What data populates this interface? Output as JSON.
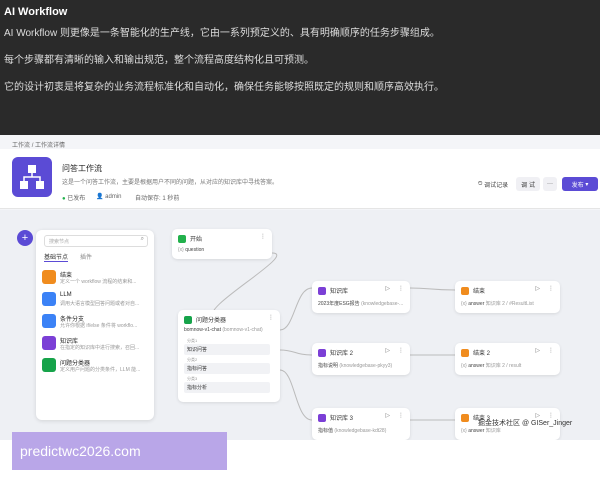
{
  "header": {
    "title": "AI Workflow",
    "lines": [
      "AI Workflow 则更像是一条智能化的生产线，它由一系列预定义的、具有明确顺序的任务步骤组成。",
      "每个步骤都有清晰的输入和输出规范，整个流程高度结构化且可预测。",
      "它的设计初衷是将复杂的业务流程标准化和自动化，确保任务能够按照既定的规则和顺序高效执行。"
    ]
  },
  "breadcrumb": {
    "root": "工作流",
    "sep": "/",
    "current": "工作流详情"
  },
  "workflow": {
    "name": "问答工作流",
    "description": "这是一个问答工作流，主要是根据用户不同的问题，从对应的知识库中寻找答案。",
    "status": "已发布",
    "owner": "admin",
    "autosave": "自动保存: 1 秒前"
  },
  "toolbar": {
    "debug_log": "调试记录",
    "debug": "调 试",
    "more": "···",
    "publish": "发布"
  },
  "panel": {
    "search_placeholder": "搜索节点",
    "tabs": [
      "基础节点",
      "插件"
    ],
    "items": [
      {
        "name": "结束",
        "desc": "定义一个 workflow 流程的结束和..."
      },
      {
        "name": "LLM",
        "desc": "调用大语言模型回答问题或者对自..."
      },
      {
        "name": "条件分支",
        "desc": "允许你根据 if/else 条件将 workflo..."
      },
      {
        "name": "知识库",
        "desc": "在指定的知识库中进行搜索，召回..."
      },
      {
        "name": "问题分类器",
        "desc": "定义用户问题的分类条件，LLM 能..."
      }
    ]
  },
  "nodes": {
    "start": {
      "title": "开始",
      "var": "question"
    },
    "classifier": {
      "title": "问题分类器",
      "model": "bomnow-v1-chat",
      "model_sub": "(bomnow-v1-chat)",
      "classes": [
        {
          "label": "分类1",
          "value": "知识问答"
        },
        {
          "label": "分类2",
          "value": "指标问答"
        },
        {
          "label": "分类3",
          "value": "指标分析"
        }
      ]
    },
    "kb1": {
      "title": "知识库",
      "entry": "2023年度ESG报告",
      "sub": "(knowledgebase-..."
    },
    "kb2": {
      "title": "知识库 2",
      "entry": "指标说明",
      "sub": "(knowledgebase-pkyy3)"
    },
    "kb3": {
      "title": "知识库 3",
      "entry": "指标值",
      "sub": "(knowledgebase-kdt28)"
    },
    "end1": {
      "title": "结束",
      "var": "answer",
      "ref": "知识库 2 / #ResultList"
    },
    "end2": {
      "title": "结束 2",
      "var": "answer",
      "ref": "知识库 2 / result"
    },
    "end3": {
      "title": "结束 3",
      "var": "answer",
      "ref": "知识库"
    }
  },
  "watermarks": {
    "site": "predictwc2026.com",
    "corner": "掘金技术社区 @ GISer_Jinger"
  },
  "colors": {
    "accent": "#5b4bd5",
    "start": "#22b14c",
    "kb": "#7b3fd6",
    "end": "#f08c1e",
    "cond": "#3b82f6",
    "cls": "#16a34a"
  }
}
